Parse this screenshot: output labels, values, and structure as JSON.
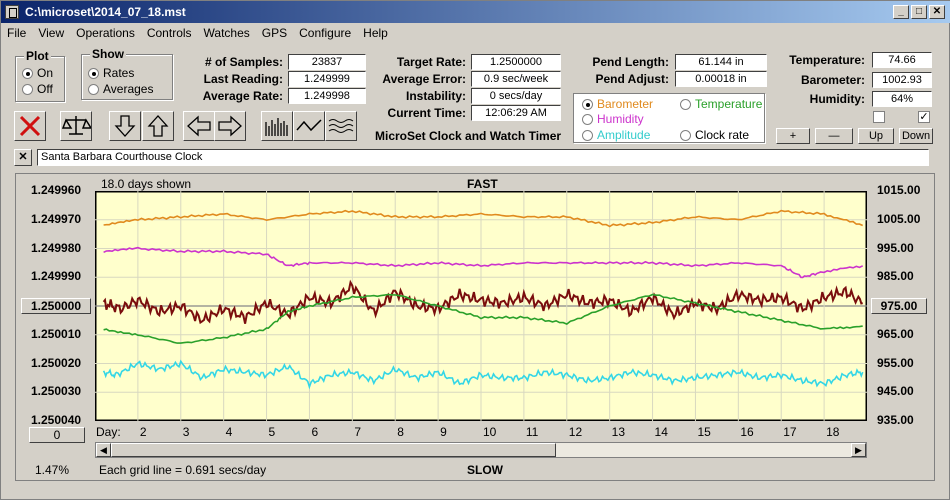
{
  "window": {
    "title": "C:\\microset\\2014_07_18.mst"
  },
  "menu": [
    "File",
    "View",
    "Operations",
    "Controls",
    "Watches",
    "GPS",
    "Configure",
    "Help"
  ],
  "plot_group": {
    "title": "Plot",
    "options": [
      "On",
      "Off"
    ],
    "selected": "On"
  },
  "show_group": {
    "title": "Show",
    "options": [
      "Rates",
      "Averages"
    ],
    "selected": "Rates"
  },
  "stats": {
    "samples_label": "# of Samples:",
    "samples": "23837",
    "last_reading_label": "Last Reading:",
    "last_reading": "1.249999",
    "average_rate_label": "Average Rate:",
    "average_rate": "1.249998",
    "target_rate_label": "Target Rate:",
    "target_rate": "1.2500000",
    "average_error_label": "Average Error:",
    "average_error": "0.9 sec/week",
    "instability_label": "Instability:",
    "instability": "0 secs/day",
    "current_time_label": "Current Time:",
    "current_time": "12:06:29 AM",
    "app_name": "MicroSet Clock and Watch Timer",
    "pend_length_label": "Pend Length:",
    "pend_length": "61.144 in",
    "pend_adjust_label": "Pend Adjust:",
    "pend_adjust": "0.00018 in",
    "temperature_label": "Temperature:",
    "temperature": "74.66",
    "barometer_label": "Barometer:",
    "barometer": "1002.93",
    "humidity_label": "Humidity:",
    "humidity": "64%"
  },
  "series_options": [
    {
      "label": "Barometer",
      "color": "#e08a1e",
      "selected": true
    },
    {
      "label": "Temperature",
      "color": "#2aa02a",
      "selected": false
    },
    {
      "label": "Humidity",
      "color": "#cc33cc",
      "selected": false
    },
    {
      "label": "Amplitude",
      "color": "#33cccc",
      "selected": false
    },
    {
      "label": "Clock rate",
      "color": "#000000",
      "selected": false
    }
  ],
  "scale_buttons": [
    "+",
    "—",
    "Up",
    "Down"
  ],
  "checkbox_right_checked": true,
  "clock_name": "Santa Barbara Courthouse Clock",
  "chart_header": {
    "days_shown": "18.0 days shown",
    "fast": "FAST",
    "slow": "SLOW",
    "grid_note": "Each grid line = 0.691 secs/day",
    "percent": "1.47%",
    "day_label": "Day:"
  },
  "center_left_button": "1.250000",
  "center_right_button": "975.00",
  "bottom_left_button": "0",
  "chart_data": {
    "type": "line",
    "x_label": "Day:",
    "x_ticks": [
      2,
      3,
      4,
      5,
      6,
      7,
      8,
      9,
      10,
      11,
      12,
      13,
      14,
      15,
      16,
      17,
      18
    ],
    "left_axis_ticks": [
      "1.249960",
      "1.249970",
      "1.249980",
      "1.249990",
      "1.250000",
      "1.250010",
      "1.250020",
      "1.250030",
      "1.250040"
    ],
    "right_axis_ticks": [
      "1015.00",
      "1005.00",
      "995.00",
      "985.00",
      "975.00",
      "965.00",
      "955.00",
      "945.00",
      "935.00"
    ],
    "xlim": [
      1,
      19
    ],
    "ylim": [
      935,
      1015
    ],
    "series": [
      {
        "color": "#e08a1e",
        "x": [
          1.2,
          2,
          3,
          4,
          5,
          6,
          7,
          8,
          9,
          10,
          11,
          12,
          13,
          14,
          15,
          16,
          17,
          18,
          18.9
        ],
        "values": [
          1003,
          1005,
          1006,
          1007,
          1005,
          1007,
          1008,
          1006,
          1006,
          1007,
          1006,
          1006,
          1003,
          1004,
          1006,
          1005,
          1008,
          1007,
          1003
        ]
      },
      {
        "color": "#cc33cc",
        "x": [
          1.2,
          2,
          3,
          4,
          5,
          5.5,
          6,
          7,
          8,
          9,
          10,
          11,
          12,
          13,
          14,
          15,
          16,
          17,
          17.5,
          18,
          18.9
        ],
        "values": [
          994,
          995,
          994,
          994,
          993,
          989,
          990,
          990,
          989,
          990,
          989,
          990,
          990,
          990,
          990,
          989,
          990,
          989,
          985,
          987,
          989
        ]
      },
      {
        "color": "#7a0d0d",
        "x": [
          1.2,
          1.6,
          2,
          2.5,
          3,
          3.5,
          4,
          4.5,
          5,
          5.5,
          6,
          6.5,
          7,
          7.5,
          8,
          8.5,
          9,
          9.5,
          10,
          10.5,
          11,
          11.5,
          12,
          12.5,
          13,
          13.5,
          14,
          14.5,
          15,
          15.5,
          16,
          16.5,
          17,
          17.5,
          18,
          18.5,
          18.9
        ],
        "values": [
          976,
          974,
          977,
          973,
          975,
          970,
          974,
          971,
          976,
          972,
          978,
          976,
          982,
          973,
          980,
          975,
          974,
          979,
          977,
          976,
          978,
          975,
          979,
          976,
          977,
          973,
          978,
          972,
          976,
          974,
          979,
          977,
          978,
          974,
          978,
          980,
          976
        ]
      },
      {
        "color": "#2aa02a",
        "x": [
          1.2,
          2,
          3,
          4,
          5,
          5.5,
          6,
          7,
          8,
          9,
          10,
          11,
          12,
          13,
          14,
          15,
          16,
          17,
          18,
          18.9
        ],
        "values": [
          967,
          965,
          962,
          964,
          967,
          973,
          975,
          978,
          979,
          975,
          971,
          971,
          969,
          975,
          979,
          976,
          973,
          970,
          967,
          968
        ]
      },
      {
        "color": "#33d6e6",
        "x": [
          1.2,
          1.5,
          2,
          2.5,
          3,
          3.5,
          4,
          4.5,
          5,
          5.5,
          6,
          6.5,
          7,
          7.5,
          8,
          8.5,
          9,
          9.5,
          10,
          10.5,
          11,
          11.5,
          12,
          12.5,
          13,
          13.5,
          14,
          14.5,
          15,
          15.5,
          16,
          16.5,
          17,
          17.5,
          18,
          18.5,
          18.9
        ],
        "values": [
          952,
          951,
          955,
          953,
          955,
          950,
          953,
          952,
          951,
          954,
          948,
          951,
          952,
          949,
          953,
          950,
          952,
          948,
          951,
          950,
          950,
          952,
          951,
          949,
          950,
          952,
          951,
          949,
          950,
          951,
          952,
          950,
          951,
          949,
          948,
          951,
          952
        ]
      }
    ]
  }
}
